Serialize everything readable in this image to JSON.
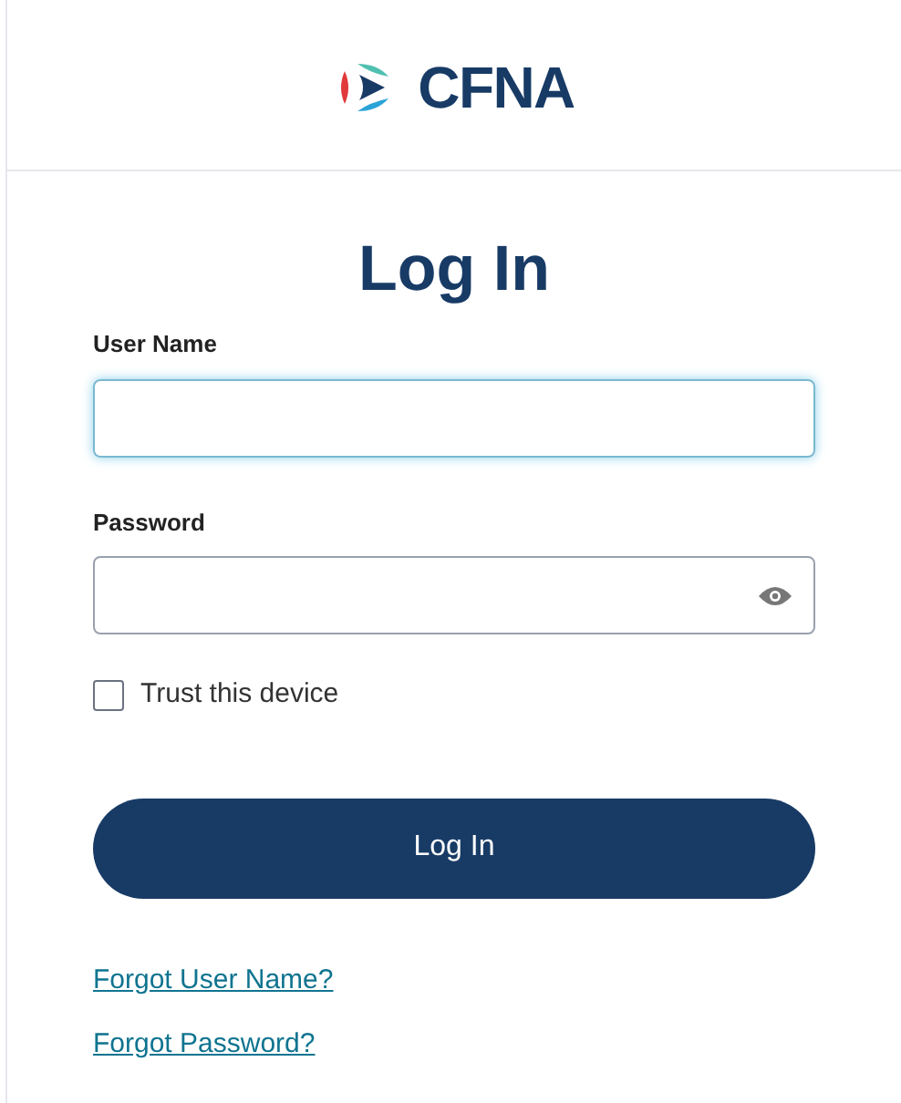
{
  "logo": {
    "text": "CFNA"
  },
  "title": "Log In",
  "fields": [
    {
      "label": "User Name",
      "kind": "text",
      "focused": true
    },
    {
      "label": "Password",
      "kind": "password",
      "focused": false
    }
  ],
  "trust_device": {
    "label": "Trust this device",
    "checked": false
  },
  "submit": "Log In",
  "links": [
    "Forgot User Name?",
    "Forgot Password?"
  ]
}
